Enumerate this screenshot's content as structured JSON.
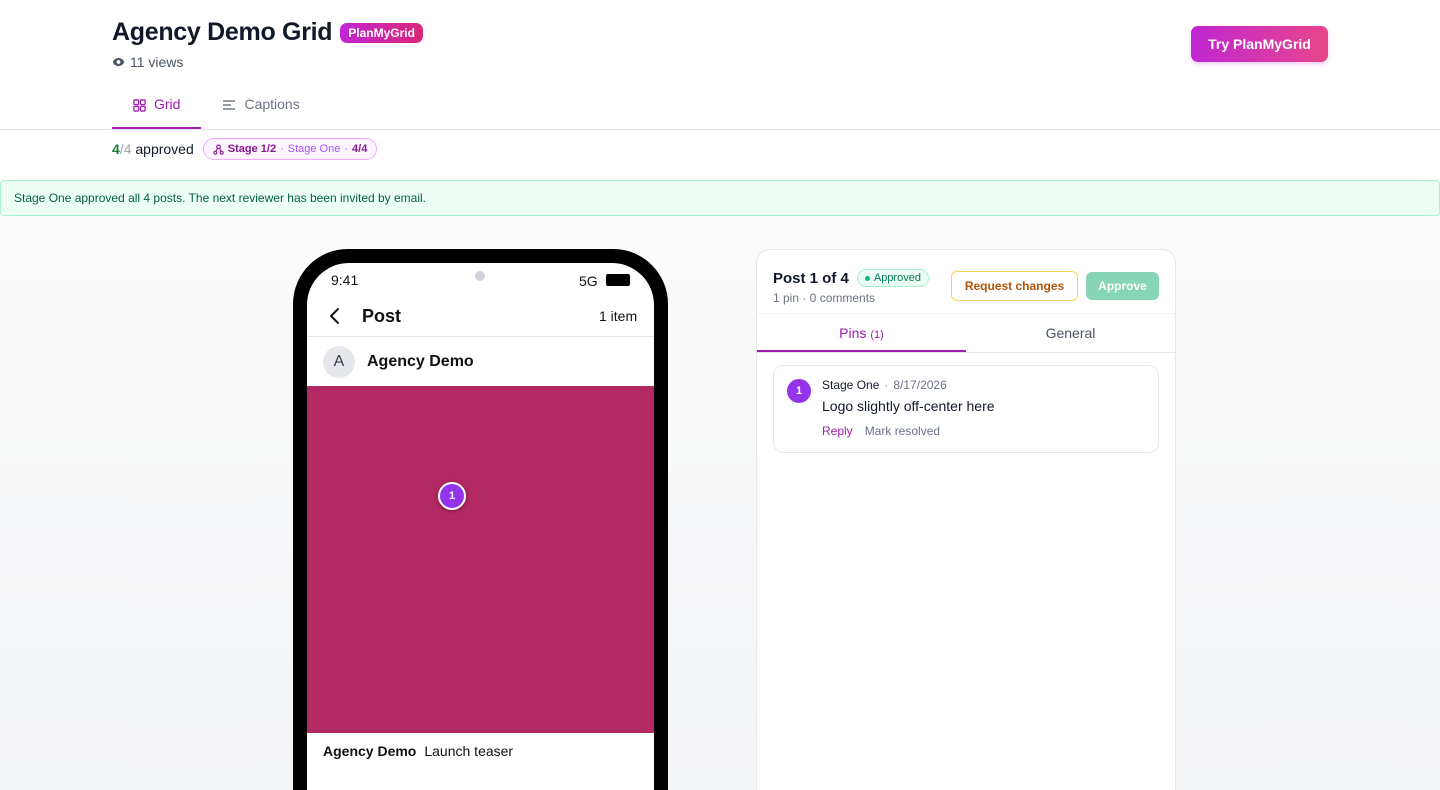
{
  "header": {
    "title": "Agency Demo Grid",
    "brand_badge": "PlanMyGrid",
    "views": "11 views",
    "try_button": "Try PlanMyGrid"
  },
  "tabs": [
    {
      "label": "Grid",
      "icon": "grid-icon",
      "active": true
    },
    {
      "label": "Captions",
      "icon": "captions-icon",
      "active": false
    }
  ],
  "status": {
    "approved_num": "4",
    "approved_sep": "/",
    "approved_total": "4",
    "approved_label": "approved",
    "stage": "Stage 1/2",
    "stage_sep1": "·",
    "stage_name": "Stage One",
    "stage_sep2": "·",
    "stage_count": "4/4"
  },
  "banner": {
    "text": "Stage One approved all 4 posts. The next reviewer has been invited by email."
  },
  "phone": {
    "time": "9:41",
    "network": "5G",
    "nav_title": "Post",
    "item_count": "1 item",
    "avatar_letter": "A",
    "author": "Agency Demo",
    "media_color": "#b32961",
    "pin_number": "1",
    "caption_author": "Agency Demo",
    "caption_text": "Launch teaser"
  },
  "panel": {
    "post_label": "Post 1 of 4",
    "status_badge": "Approved",
    "sub": "1 pin · 0 comments",
    "request_changes": "Request changes",
    "approve": "Approve",
    "tabs": [
      {
        "label": "Pins",
        "count": "(1)",
        "active": true
      },
      {
        "label": "General",
        "count": "",
        "active": false
      }
    ],
    "comments": [
      {
        "number": "1",
        "author": "Stage One",
        "sep": "·",
        "date": "8/17/2026",
        "text": "Logo slightly off-center here",
        "reply": "Reply",
        "resolve": "Mark resolved"
      }
    ]
  },
  "colors": {
    "accent": "#a21caf",
    "brand_gradient_start": "#c026d3",
    "brand_gradient_end": "#db2777",
    "approved_green": "#15803d",
    "banner_bg": "#ecfdf5",
    "pin_purple": "#9333ea"
  }
}
